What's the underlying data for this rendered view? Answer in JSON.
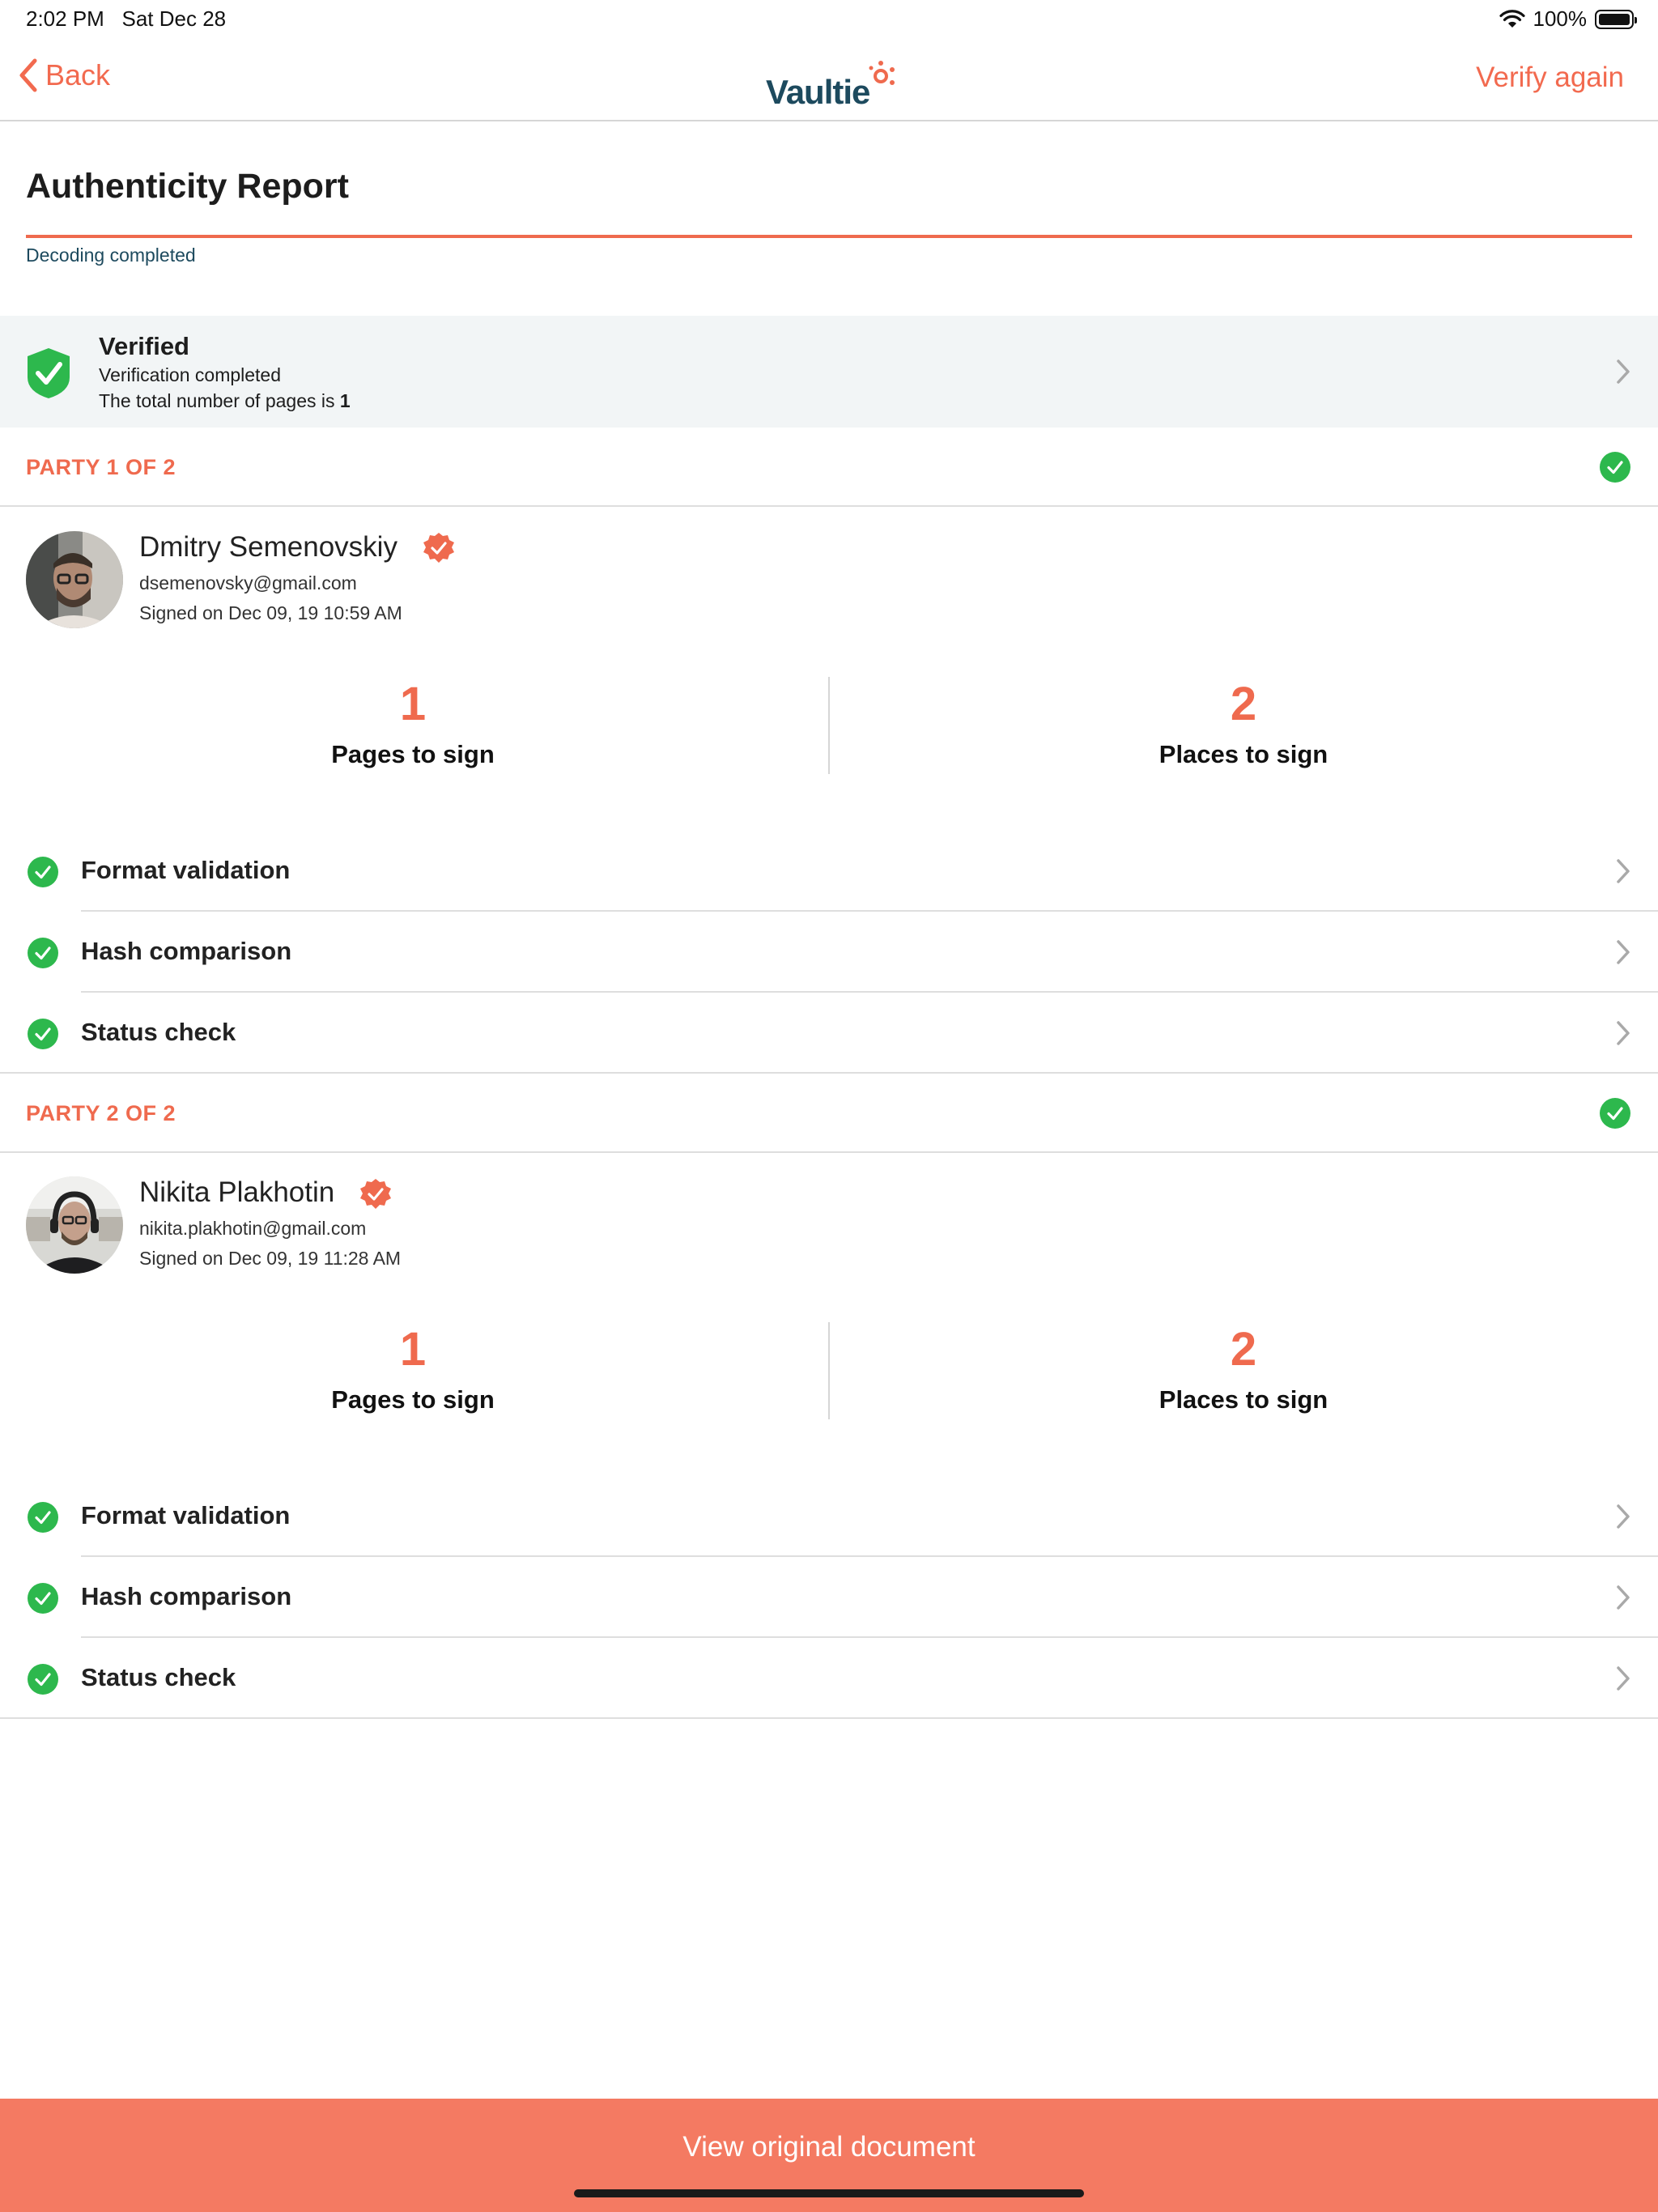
{
  "status_bar": {
    "time": "2:02 PM",
    "date": "Sat Dec 28",
    "battery": "100%"
  },
  "nav": {
    "back_label": "Back",
    "logo_text": "Vaultie",
    "verify_again_label": "Verify again"
  },
  "report": {
    "title": "Authenticity Report",
    "progress_label": "Decoding completed",
    "progress": 1.0
  },
  "verification": {
    "title": "Verified",
    "line1": "Verification completed",
    "line2_prefix": "The total number of pages is ",
    "line2_value": "1"
  },
  "parties": [
    {
      "header": "PARTY 1 OF 2",
      "name": "Dmitry Semenovskiy",
      "email": "dsemenovsky@gmail.com",
      "signed": "Signed on Dec 09, 19 10:59 AM",
      "pages_value": "1",
      "pages_label": "Pages to sign",
      "places_value": "2",
      "places_label": "Places to sign",
      "checks": [
        "Format validation",
        "Hash comparison",
        "Status check"
      ]
    },
    {
      "header": "PARTY 2 OF 2",
      "name": "Nikita Plakhotin",
      "email": "nikita.plakhotin@gmail.com",
      "signed": "Signed on Dec 09, 19 11:28 AM",
      "pages_value": "1",
      "pages_label": "Pages to sign",
      "places_value": "2",
      "places_label": "Places to sign",
      "checks": [
        "Format validation",
        "Hash comparison",
        "Status check"
      ]
    }
  ],
  "footer": {
    "button_label": "View original document"
  },
  "colors": {
    "accent": "#ef6a4e",
    "success": "#2db84d",
    "brand_dark": "#1d4a5e",
    "button": "#f47a62"
  }
}
